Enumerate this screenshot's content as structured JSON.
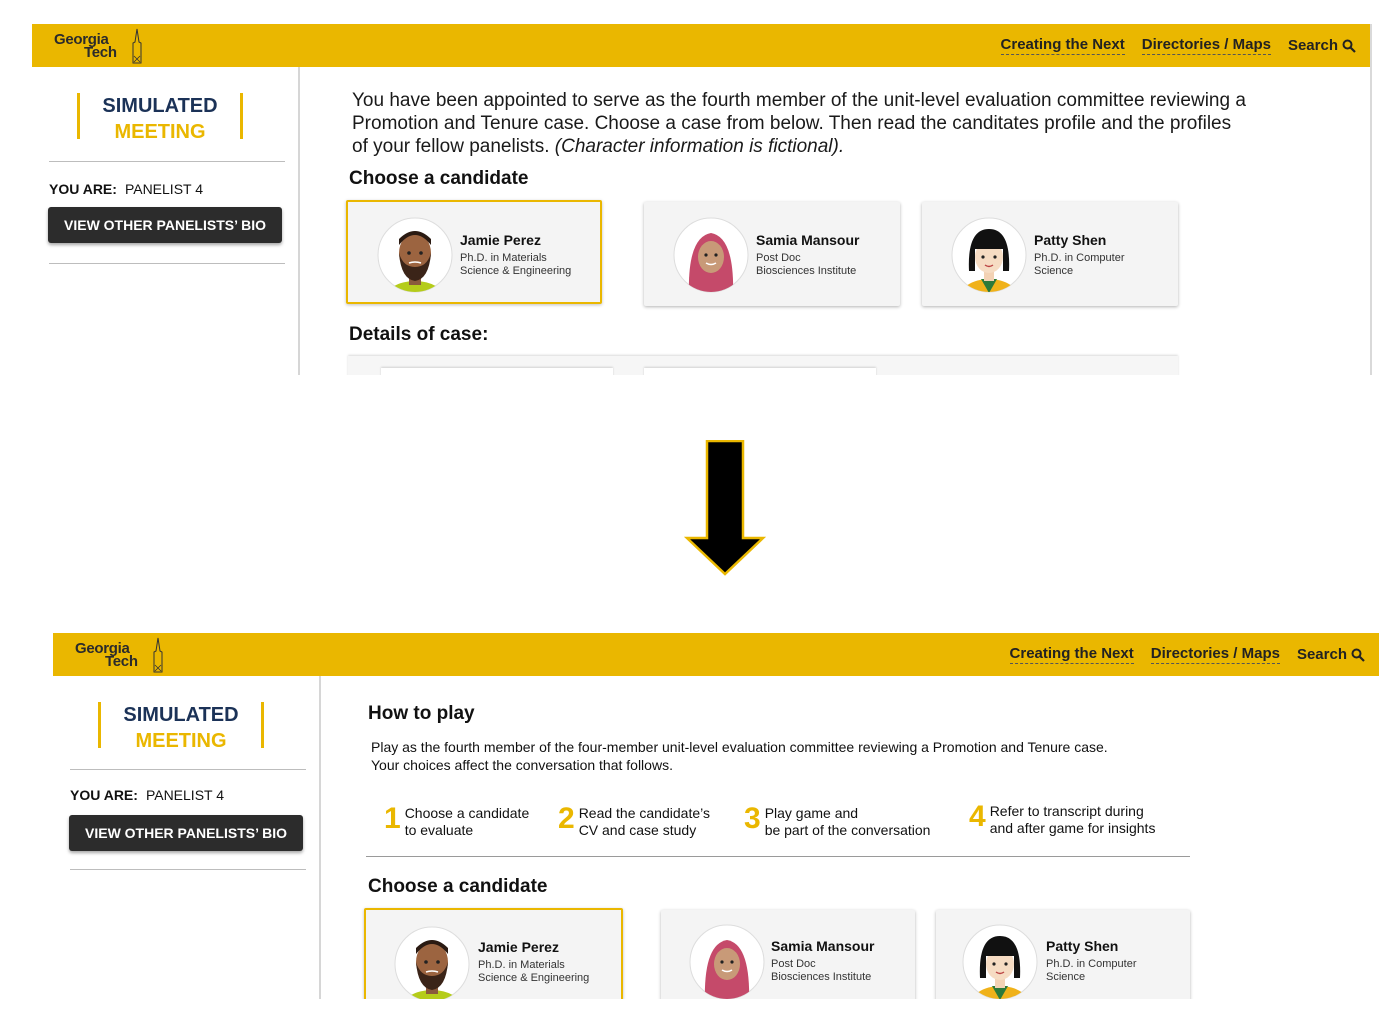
{
  "brand": {
    "line1": "Georgia",
    "line2": "Tech"
  },
  "topnav": {
    "links": [
      "Creating the Next",
      "Directories / Maps"
    ],
    "search_label": "Search"
  },
  "sidebar": {
    "title_line1": "SIMULATED",
    "title_line2": "MEETING",
    "you_are_label": "YOU ARE:",
    "you_are_value": "PANELIST 4",
    "bio_button": "VIEW OTHER PANELISTS’ BIO"
  },
  "before": {
    "intro_main": "You have been appointed to serve as the fourth member of the unit-level evaluation committee reviewing a Promotion and Tenure case. Choose a case from below. Then read the canditates profile and the profiles of your fellow panelists.",
    "intro_italic": "(Character information is fictional).",
    "choose_heading": "Choose a candidate",
    "details_heading": "Details of case:"
  },
  "after": {
    "how_heading": "How to play",
    "how_line1": "Play as the fourth member of the four-member unit-level evaluation committee reviewing a Promotion and Tenure case.",
    "how_line2": "Your choices affect the conversation that follows.",
    "steps": [
      {
        "num": "1",
        "line1": "Choose a candidate",
        "line2": "to evaluate"
      },
      {
        "num": "2",
        "line1": "Read the candidate’s",
        "line2": "CV and case study"
      },
      {
        "num": "3",
        "line1": "Play game and",
        "line2": "be part of the conversation"
      },
      {
        "num": "4",
        "line1": "Refer to transcript during",
        "line2": "and after game for insights"
      }
    ],
    "choose_heading": "Choose a candidate"
  },
  "candidates": [
    {
      "name": "Jamie Perez",
      "line1": "Ph.D. in Materials",
      "line2": "Science & Engineering",
      "selected": true
    },
    {
      "name": "Samia Mansour",
      "line1": "Post Doc",
      "line2": "Biosciences Institute",
      "selected": false
    },
    {
      "name": "Patty Shen",
      "line1": "Ph.D. in Computer",
      "line2": "Science",
      "selected": false
    }
  ],
  "colors": {
    "gold": "#eab700",
    "navy": "#1b3257",
    "dark_button": "#2c2c2c"
  }
}
